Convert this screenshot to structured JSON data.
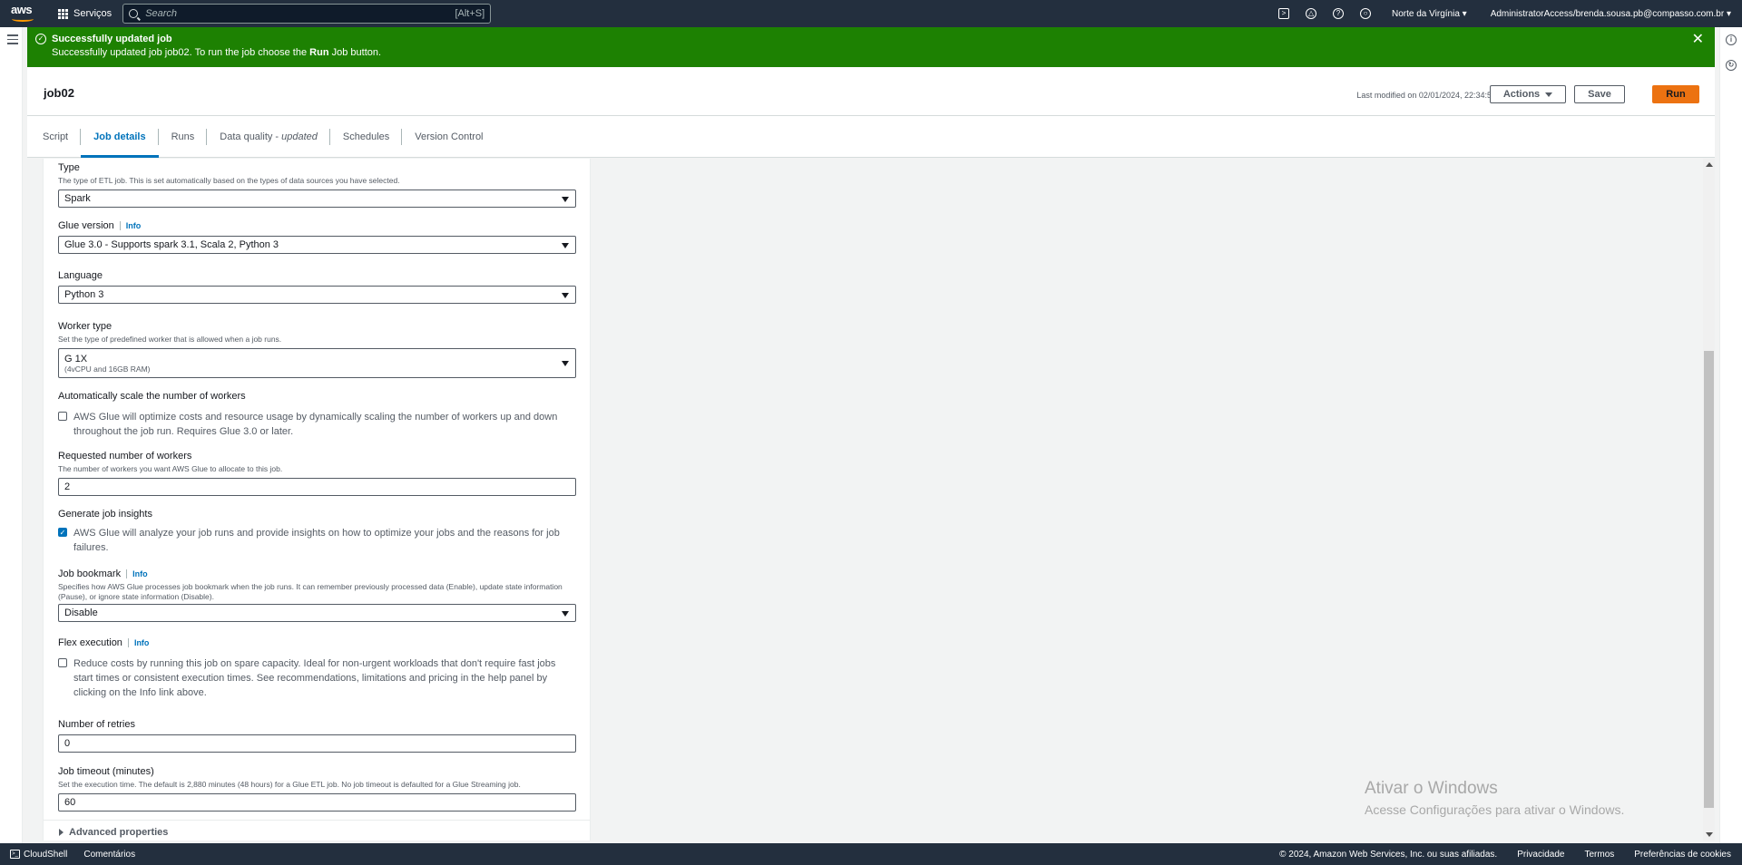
{
  "nav": {
    "logo": "aws",
    "services_label": "Serviços",
    "search_placeholder": "Search",
    "search_shortcut": "[Alt+S]",
    "region": "Norte da Virgínia",
    "account": "AdministratorAccess/brenda.sousa.pb@compasso.com.br",
    "icons": [
      "cloudshell-icon",
      "bell-icon",
      "help-icon",
      "settings-icon"
    ]
  },
  "flash": {
    "title": "Successfully updated job",
    "message_pre": "Successfully updated job job02. To run the job choose the ",
    "message_bold": "Run",
    "message_post": " Job button."
  },
  "header": {
    "job_name": "job02",
    "last_modified": "Last modified on 02/01/2024, 22:34:59",
    "actions_label": "Actions",
    "save_label": "Save",
    "run_label": "Run"
  },
  "tabs": [
    {
      "label": "Script"
    },
    {
      "label": "Job details",
      "active": true
    },
    {
      "label": "Runs"
    },
    {
      "label": "Data quality - ",
      "suffix": "updated"
    },
    {
      "label": "Schedules"
    },
    {
      "label": "Version Control"
    }
  ],
  "form": {
    "type": {
      "label": "Type",
      "desc": "The type of ETL job. This is set automatically based on the types of data sources you have selected.",
      "value": "Spark"
    },
    "glue_version": {
      "label": "Glue version",
      "info": "Info",
      "value": "Glue 3.0 - Supports spark 3.1, Scala 2, Python 3"
    },
    "language": {
      "label": "Language",
      "value": "Python 3"
    },
    "worker_type": {
      "label": "Worker type",
      "desc": "Set the type of predefined worker that is allowed when a job runs.",
      "value": "G 1X",
      "sub": "(4vCPU and 16GB RAM)"
    },
    "autoscale": {
      "label": "Automatically scale the number of workers",
      "text": "AWS Glue will optimize costs and resource usage by dynamically scaling the number of workers up and down throughout the job run. Requires Glue 3.0 or later.",
      "checked": false
    },
    "workers": {
      "label": "Requested number of workers",
      "desc": "The number of workers you want AWS Glue to allocate to this job.",
      "value": "2"
    },
    "insights": {
      "label": "Generate job insights",
      "text": "AWS Glue will analyze your job runs and provide insights on how to optimize your jobs and the reasons for job failures.",
      "checked": true
    },
    "bookmark": {
      "label": "Job bookmark",
      "info": "Info",
      "desc": "Specifies how AWS Glue processes job bookmark when the job runs. It can remember previously processed data (Enable), update state information (Pause), or ignore state information (Disable).",
      "value": "Disable"
    },
    "flex": {
      "label": "Flex execution",
      "info": "Info",
      "text": "Reduce costs by running this job on spare capacity. Ideal for non-urgent workloads that don't require fast jobs start times or consistent execution times. See recommendations, limitations and pricing in the help panel by clicking on the Info link above.",
      "checked": false
    },
    "retries": {
      "label": "Number of retries",
      "value": "0"
    },
    "timeout": {
      "label": "Job timeout (minutes)",
      "desc": "Set the execution time. The default is 2,880 minutes (48 hours) for a Glue ETL job. No job timeout is defaulted for a Glue Streaming job.",
      "value": "60"
    },
    "advanced": "Advanced properties"
  },
  "watermark": {
    "line1": "Ativar o Windows",
    "line2": "Acesse Configurações para ativar o Windows."
  },
  "footer": {
    "cloudshell": "CloudShell",
    "comments": "Comentários",
    "copyright": "© 2024, Amazon Web Services, Inc. ou suas afiliadas.",
    "privacy": "Privacidade",
    "terms": "Termos",
    "cookies": "Preferências de cookies"
  },
  "colors": {
    "nav_bg": "#232f3e",
    "flash_success": "#1d8102",
    "primary_button": "#ec7211",
    "link_blue": "#0073bb"
  }
}
